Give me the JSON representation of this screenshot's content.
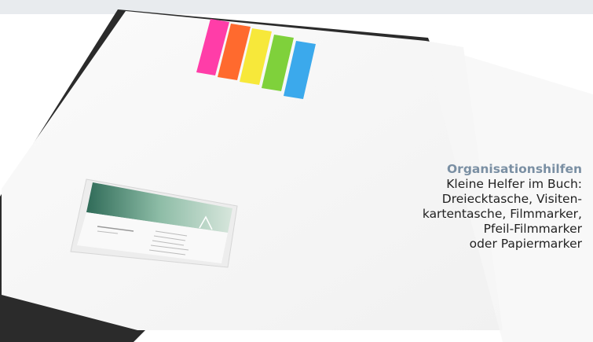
{
  "caption": {
    "heading": "Organisationshilfen",
    "lines": [
      "Kleine Helfer im Buch:",
      "Dreiecktasche, Visiten-",
      "kartentasche, Filmmarker,",
      "Pfeil-Filmmarker",
      "oder Papiermarker"
    ],
    "heading_color": "#7a8fa3"
  },
  "image": {
    "subject": "notebook-with-sticky-markers-and-business-card-pocket",
    "marker_colors": [
      "#ff3da8",
      "#ff6a2e",
      "#f7e83a",
      "#7fd13b",
      "#3ba9ec"
    ]
  }
}
